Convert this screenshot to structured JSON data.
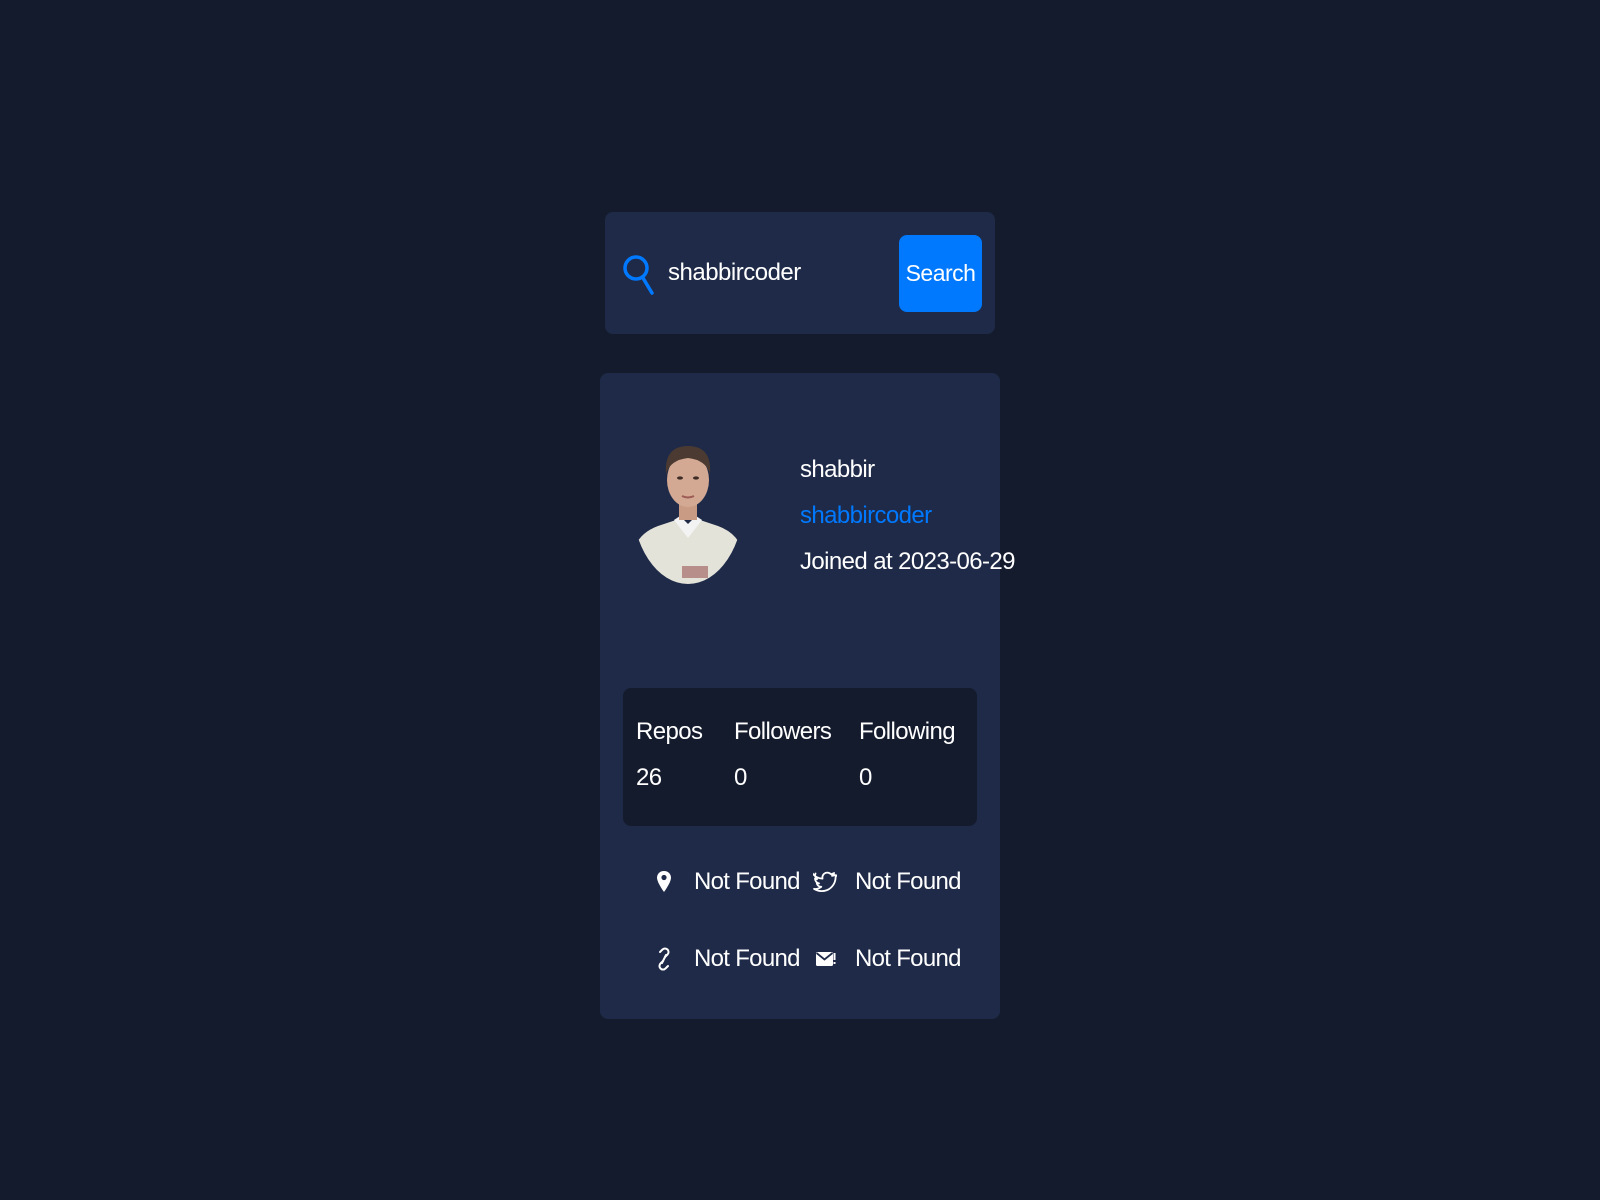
{
  "search": {
    "value": "shabbircoder",
    "placeholder": "",
    "button_label": "Search"
  },
  "profile": {
    "name": "shabbir",
    "login": "shabbircoder",
    "joined": "Joined at 2023-06-29"
  },
  "stats": [
    {
      "label": "Repos",
      "value": "26"
    },
    {
      "label": "Followers",
      "value": "0"
    },
    {
      "label": "Following",
      "value": "0"
    }
  ],
  "links": {
    "location": {
      "icon": "map-pin-icon",
      "text": "Not Found"
    },
    "twitter": {
      "icon": "twitter-icon",
      "text": "Not Found"
    },
    "website": {
      "icon": "link-icon",
      "text": "Not Found"
    },
    "email": {
      "icon": "mail-icon",
      "text": "Not Found"
    }
  },
  "colors": {
    "background": "#141b2d",
    "card": "#1e2a47",
    "accent": "#0079ff",
    "text": "#ffffff"
  }
}
